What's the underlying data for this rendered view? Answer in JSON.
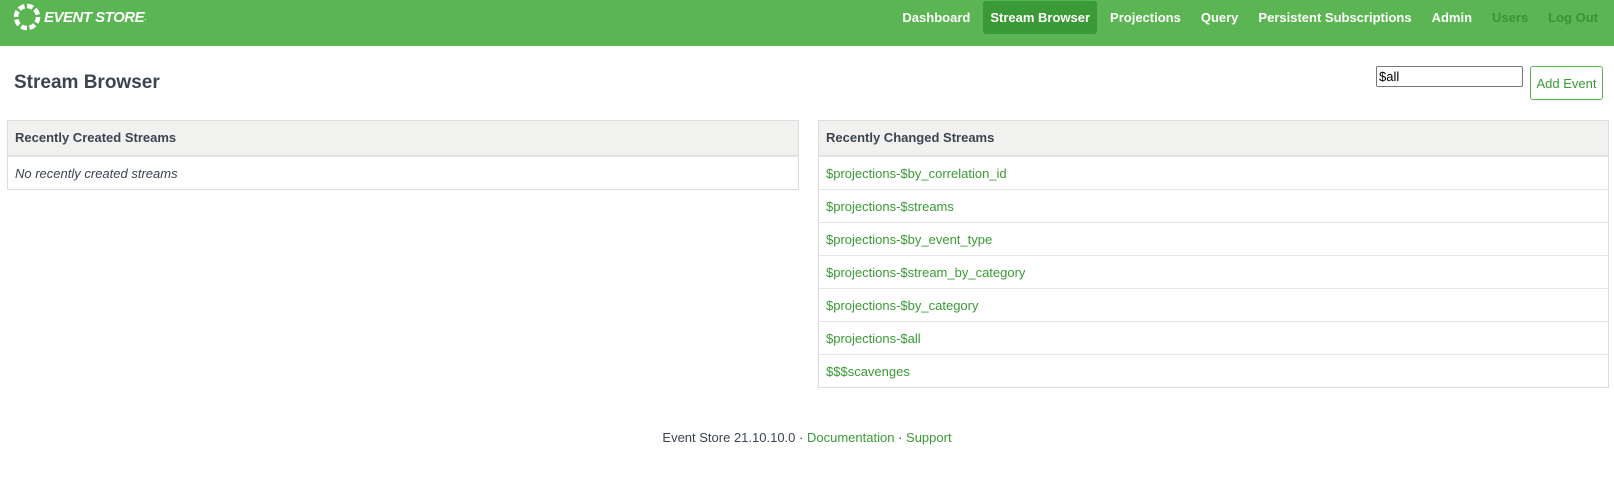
{
  "app": {
    "logo_text": "EVENT STORE",
    "logo_icon": "eventstore-ring-logo",
    "brand_color": "#5ab552",
    "accent_dark": "#3a9a35"
  },
  "nav": {
    "items": [
      {
        "label": "Dashboard"
      },
      {
        "label": "Stream Browser"
      },
      {
        "label": "Projections"
      },
      {
        "label": "Query"
      },
      {
        "label": "Persistent Subscriptions"
      },
      {
        "label": "Admin"
      },
      {
        "label": "Users"
      },
      {
        "label": "Log Out"
      }
    ],
    "active": "Stream Browser"
  },
  "page": {
    "title": "Stream Browser"
  },
  "search": {
    "value": "$all"
  },
  "actions": {
    "add_event_label": "Add Event"
  },
  "recently_created": {
    "header": "Recently Created Streams",
    "empty_text": "No recently created streams",
    "items": []
  },
  "recently_changed": {
    "header": "Recently Changed Streams",
    "items": [
      "$projections-$by_correlation_id",
      "$projections-$streams",
      "$projections-$by_event_type",
      "$projections-$stream_by_category",
      "$projections-$by_category",
      "$projections-$all",
      "$$$scavenges"
    ]
  },
  "footer": {
    "version_text": "Event Store 21.10.10.0",
    "separator": "·",
    "documentation_label": "Documentation",
    "support_label": "Support"
  }
}
